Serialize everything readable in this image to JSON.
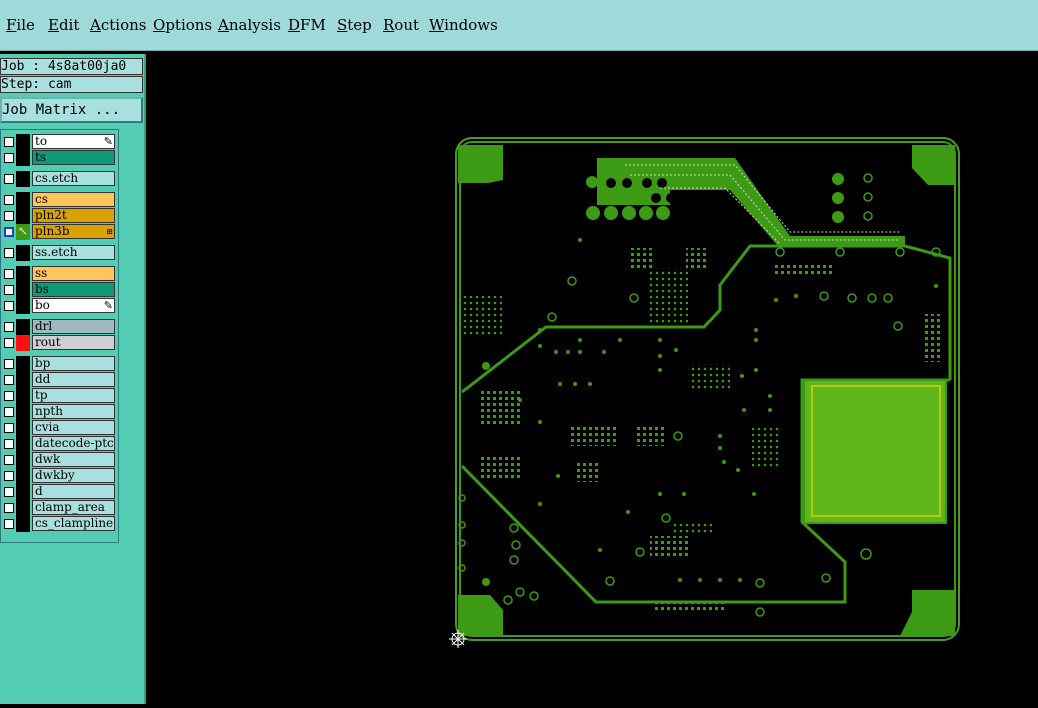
{
  "menu": [
    "File",
    "Edit",
    "Actions",
    "Options",
    "Analysis",
    "DFM",
    "Step",
    "Rout",
    "Windows"
  ],
  "job_label": "Job : 4s8at00ja0",
  "step_label": "Step: cam",
  "job_matrix_label": "Job Matrix ...",
  "layers": [
    {
      "name": "to",
      "color": "#ffffff",
      "checked": false,
      "brush": true
    },
    {
      "name": "ts",
      "color": "#0d9a7a",
      "checked": false
    },
    {
      "name": "cs.etch",
      "color": "#a7e0df",
      "checked": false
    },
    {
      "name": "cs",
      "color": "#ffc55a",
      "checked": false
    },
    {
      "name": "pln2t",
      "color": "#d9a200",
      "checked": false
    },
    {
      "name": "pln3b",
      "color": "#d9a200",
      "checked": true,
      "active": true
    },
    {
      "name": "ss.etch",
      "color": "#a7e0df",
      "checked": false
    },
    {
      "name": "ss",
      "color": "#ffc55a",
      "checked": false
    },
    {
      "name": "bs",
      "color": "#0d9a7a",
      "checked": false
    },
    {
      "name": "bo",
      "color": "#ffffff",
      "checked": false,
      "brush": true
    },
    {
      "name": "drl",
      "color": "#a0b8c0",
      "checked": false
    },
    {
      "name": "rout",
      "color": "#d0d0d0",
      "checked": false,
      "red": true
    },
    {
      "name": "bp",
      "color": "#a7e0df",
      "checked": false
    },
    {
      "name": "dd",
      "color": "#a7e0df",
      "checked": false
    },
    {
      "name": "tp",
      "color": "#a7e0df",
      "checked": false
    },
    {
      "name": "npth",
      "color": "#a7e0df",
      "checked": false
    },
    {
      "name": "cvia",
      "color": "#a7e0df",
      "checked": false
    },
    {
      "name": "datecode-ptc",
      "color": "#a7e0df",
      "checked": false
    },
    {
      "name": "dwk",
      "color": "#a7e0df",
      "checked": false
    },
    {
      "name": "dwkby",
      "color": "#a7e0df",
      "checked": false
    },
    {
      "name": "d",
      "color": "#a7e0df",
      "checked": false
    },
    {
      "name": "clamp_area",
      "color": "#a7e0df",
      "checked": false
    },
    {
      "name": "cs_clampline",
      "color": "#a7e0df",
      "checked": false
    }
  ],
  "colors": {
    "menu_bg": "#9fd9d9",
    "panel_bg": "#52cdb4",
    "copper": "#3c9a14",
    "copper_bright": "#5fb61b",
    "highlight": "#d8d200"
  }
}
